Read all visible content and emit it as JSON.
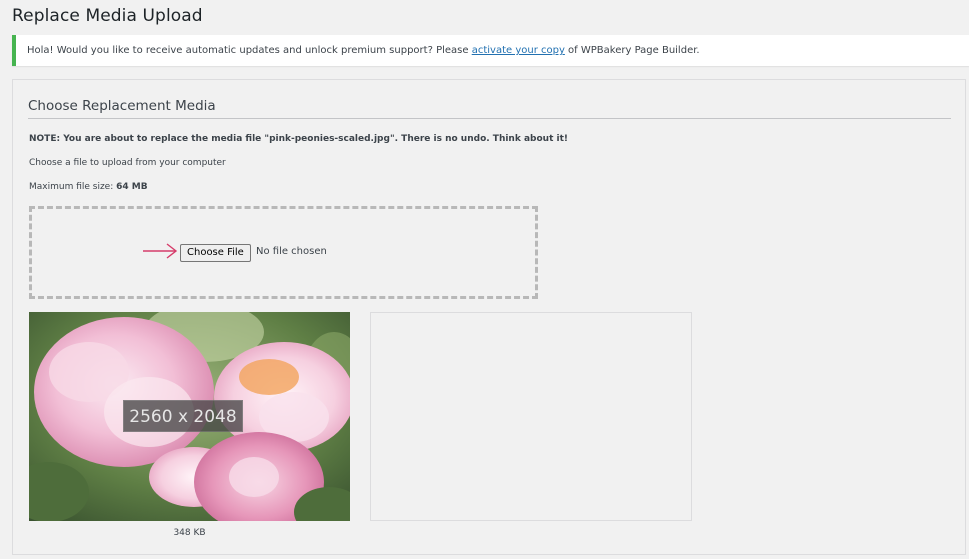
{
  "page": {
    "title": "Replace Media Upload"
  },
  "notice": {
    "text_before": "Hola! Would you like to receive automatic updates and unlock premium support? Please ",
    "link_text": "activate your copy",
    "text_after": " of WPBakery Page Builder.",
    "accent_color": "#46b450"
  },
  "panel": {
    "heading": "Choose Replacement Media",
    "note": "NOTE: You are about to replace the media file \"pink-peonies-scaled.jpg\". There is no undo. Think about it!",
    "choose_text": "Choose a file to upload from your computer",
    "max_size_label": "Maximum file size: ",
    "max_size_value": "64 MB"
  },
  "upload": {
    "button_label": "Choose File",
    "status": "No file chosen",
    "arrow_icon": "arrow-right-icon",
    "arrow_color": "#d63c6a"
  },
  "current_media": {
    "dimensions": "2560 x 2048",
    "file_size": "348 KB"
  }
}
